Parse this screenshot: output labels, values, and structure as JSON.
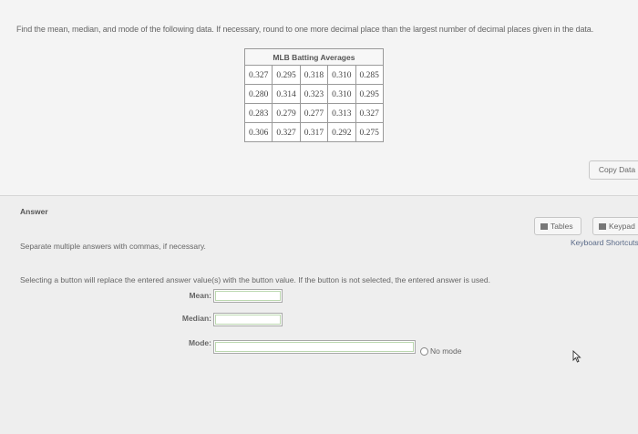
{
  "question": "Find the mean, median, and mode of the following data. If necessary, round to one more decimal place than the largest number of decimal places given in the data.",
  "table": {
    "title": "MLB Batting Averages",
    "rows": [
      [
        "0.327",
        "0.295",
        "0.318",
        "0.310",
        "0.285"
      ],
      [
        "0.280",
        "0.314",
        "0.323",
        "0.310",
        "0.295"
      ],
      [
        "0.283",
        "0.279",
        "0.277",
        "0.313",
        "0.327"
      ],
      [
        "0.306",
        "0.327",
        "0.317",
        "0.292",
        "0.275"
      ]
    ]
  },
  "copy_data_label": "Copy Data",
  "answer": {
    "title": "Answer",
    "tables_label": "Tables",
    "keypad_label": "Keypad",
    "keyboard_shortcuts_label": "Keyboard Shortcuts",
    "instruction1": "Separate multiple answers with commas, if necessary.",
    "instruction2": "Selecting a button will replace the entered answer value(s) with the button value. If the button is not selected, the entered answer is used.",
    "mean_label": "Mean:",
    "median_label": "Median:",
    "mode_label": "Mode:",
    "mean_value": "",
    "median_value": "",
    "mode_value": "",
    "no_mode_label": "No mode"
  },
  "icons": {
    "tables": "table-icon",
    "keypad": "keypad-icon",
    "cursor": "mouse-cursor-icon",
    "radio": "radio-icon"
  }
}
